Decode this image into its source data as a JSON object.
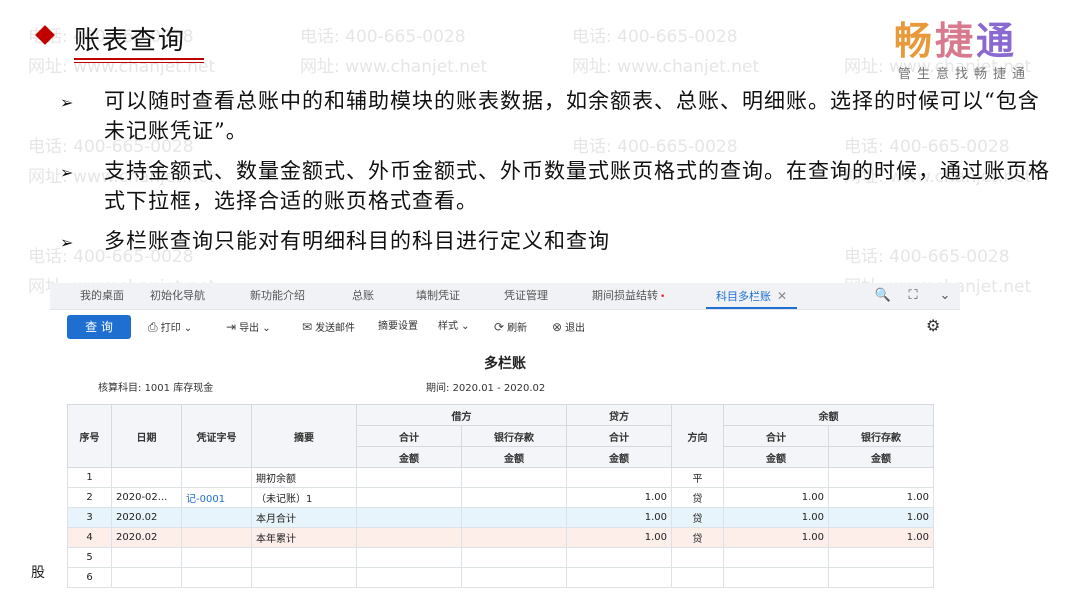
{
  "slide": {
    "title": "账表查询",
    "bullets": [
      "可以随时查看总账中的和辅助模块的账表数据，如余额表、总账、明细账。选择的时候可以“包含未记账凭证”。",
      "支持金额式、数量金额式、外币金额式、外币数量式账页格式的查询。在查询的时候，通过账页格式下拉框，选择合适的账页格式查看。",
      "多栏账查询只能对有明细科目的科目进行定义和查询"
    ],
    "bullet_marker": "➢",
    "footer_fragment": "股"
  },
  "logo": {
    "c1": "畅",
    "c2": "捷",
    "c3": "通",
    "tagline": "管生意找畅捷通"
  },
  "watermark": {
    "phone": "电话: 400-665-0028",
    "site": "网址: www.chanjet.net"
  },
  "tabs": [
    "我的桌面",
    "初始化导航",
    "新功能介绍",
    "总账",
    "填制凭证",
    "凭证管理",
    "期间损益结转",
    "科目多栏账"
  ],
  "tab_icons": {
    "search": "🔍",
    "expand": "⛶",
    "chevron": "⌄"
  },
  "toolbar": {
    "query": "查 询",
    "print": "打印",
    "export": "导出",
    "email": "发送邮件",
    "summary": "摘要设置",
    "style": "样式",
    "refresh": "刷新",
    "exit": "退出"
  },
  "report": {
    "title": "多栏账",
    "account_label": "核算科目:",
    "account_value": "1001 库存现金",
    "period_label": "期间:",
    "period_value": "2020.01 - 2020.02"
  },
  "table": {
    "headers": {
      "seq": "序号",
      "date": "日期",
      "voucher": "凭证字号",
      "summary": "摘要",
      "debit": "借方",
      "credit": "贷方",
      "direction": "方向",
      "balance": "余额",
      "total": "合计",
      "bank": "银行存款",
      "amount": "金额"
    },
    "rows": [
      {
        "seq": "1",
        "date": "",
        "voucher": "",
        "summary": "期初余额",
        "debit_total": "",
        "debit_bank": "",
        "credit_total": "",
        "dir": "平",
        "bal_total": "",
        "bal_bank": ""
      },
      {
        "seq": "2",
        "date": "2020-02...",
        "voucher": "记-0001",
        "summary": "（未记账）1",
        "debit_total": "",
        "debit_bank": "",
        "credit_total": "1.00",
        "dir": "贷",
        "bal_total": "1.00",
        "bal_bank": "1.00"
      },
      {
        "seq": "3",
        "date": "2020.02",
        "voucher": "",
        "summary": "本月合计",
        "debit_total": "",
        "debit_bank": "",
        "credit_total": "1.00",
        "dir": "贷",
        "bal_total": "1.00",
        "bal_bank": "1.00"
      },
      {
        "seq": "4",
        "date": "2020.02",
        "voucher": "",
        "summary": "本年累计",
        "debit_total": "",
        "debit_bank": "",
        "credit_total": "1.00",
        "dir": "贷",
        "bal_total": "1.00",
        "bal_bank": "1.00"
      },
      {
        "seq": "5",
        "date": "",
        "voucher": "",
        "summary": "",
        "debit_total": "",
        "debit_bank": "",
        "credit_total": "",
        "dir": "",
        "bal_total": "",
        "bal_bank": ""
      },
      {
        "seq": "6",
        "date": "",
        "voucher": "",
        "summary": "",
        "debit_total": "",
        "debit_bank": "",
        "credit_total": "",
        "dir": "",
        "bal_total": "",
        "bal_bank": ""
      }
    ]
  },
  "colors": {
    "accent": "#1f6fd1",
    "title_mark": "#c00000",
    "row_highlight": "#e7f4fb",
    "row_alt": "#fdeeea"
  }
}
